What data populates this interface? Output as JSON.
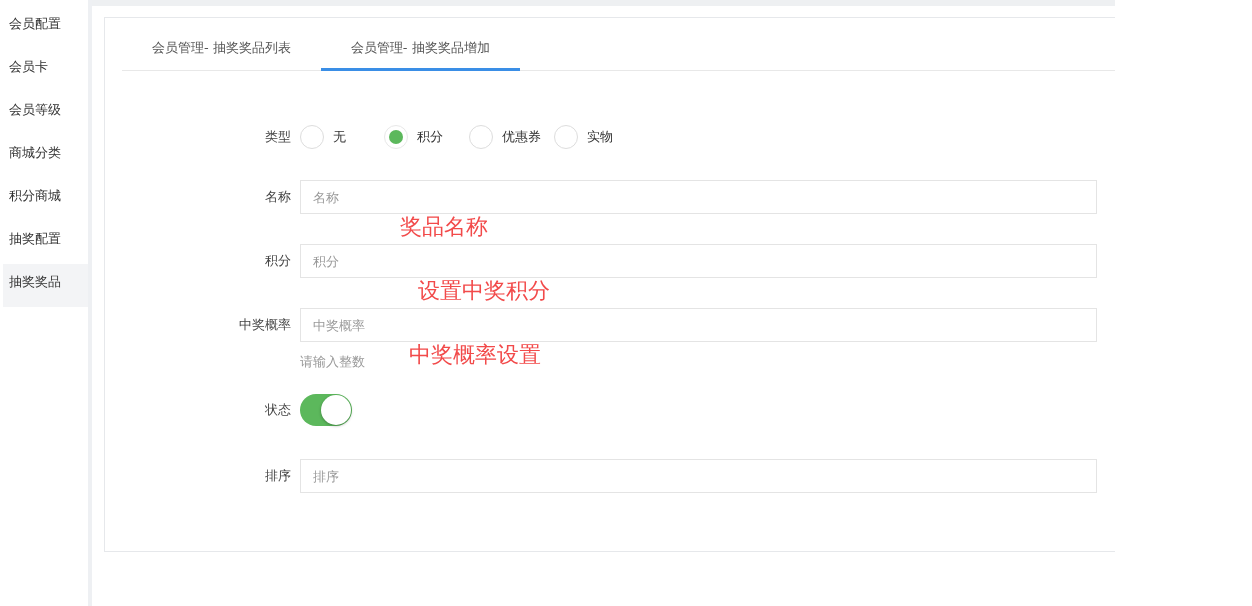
{
  "sidebar": {
    "items": [
      {
        "label": "会员配置",
        "selected": false
      },
      {
        "label": "会员卡",
        "selected": false
      },
      {
        "label": "会员等级",
        "selected": false
      },
      {
        "label": "商城分类",
        "selected": false
      },
      {
        "label": "积分商城",
        "selected": false
      },
      {
        "label": "抽奖配置",
        "selected": false
      },
      {
        "label": "抽奖奖品",
        "selected": true
      }
    ]
  },
  "tabs": [
    {
      "label": "会员管理- 抽奖奖品列表",
      "selected": false
    },
    {
      "label": "会员管理- 抽奖奖品增加",
      "selected": true
    }
  ],
  "form": {
    "fields": [
      {
        "kind": "radio",
        "label": "类型",
        "options": [
          {
            "label": "无",
            "selected": false
          },
          {
            "label": "积分",
            "selected": true
          },
          {
            "label": "优惠券",
            "selected": false
          },
          {
            "label": "实物",
            "selected": false
          }
        ]
      },
      {
        "kind": "text",
        "label": "名称",
        "placeholder": "名称",
        "annotation": "奖品名称"
      },
      {
        "kind": "text",
        "label": "积分",
        "placeholder": "积分",
        "annotation": "设置中奖积分"
      },
      {
        "kind": "text",
        "label": "中奖概率",
        "placeholder": "中奖概率",
        "annotation": "中奖概率设置",
        "hint": "请输入整数"
      },
      {
        "kind": "switch",
        "label": "状态",
        "on": true
      },
      {
        "kind": "text",
        "label": "排序",
        "placeholder": "排序"
      }
    ]
  }
}
